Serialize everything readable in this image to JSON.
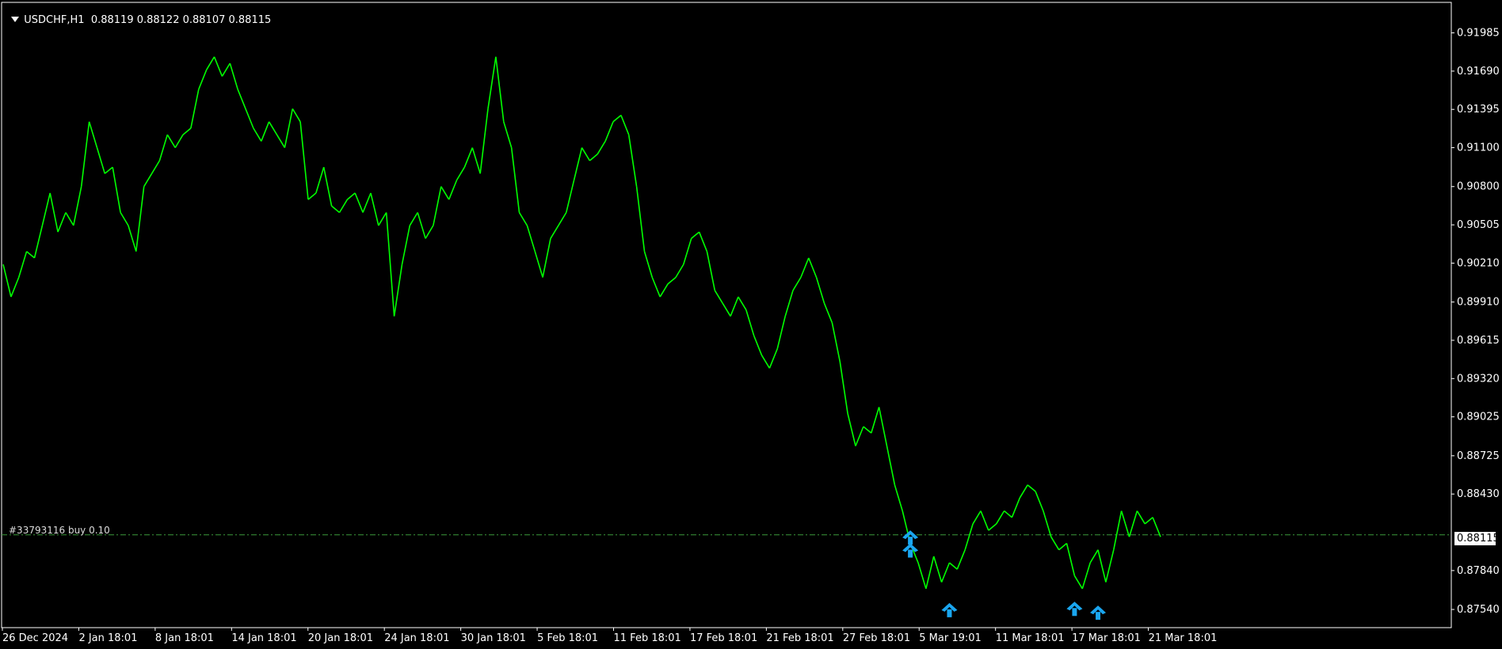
{
  "header": {
    "symbol": "USDCHF,H1",
    "ohlc": "0.88119 0.88122 0.88107 0.88115"
  },
  "order_line": {
    "label": "#33793116 buy 0.10",
    "price": 0.88115
  },
  "current_price_tag": "0.88115",
  "colors": {
    "background": "#000000",
    "price_line": "#00ff00",
    "arrow": "#1aa6f0",
    "grid_axis": "#ffffff",
    "order_line": "#3a9a3a"
  },
  "chart_data": {
    "type": "line",
    "title": "",
    "xlabel": "",
    "ylabel": "",
    "grid": false,
    "ylim": [
      0.874,
      0.9222
    ],
    "y_ticks": [
      "0.91985",
      "0.91690",
      "0.91395",
      "0.91100",
      "0.90800",
      "0.90505",
      "0.90210",
      "0.89910",
      "0.89615",
      "0.89320",
      "0.89025",
      "0.88725",
      "0.88430",
      "0.87840",
      "0.87540"
    ],
    "x_ticks": [
      "26 Dec 2024",
      "2 Jan 18:01",
      "8 Jan 18:01",
      "14 Jan 18:01",
      "20 Jan 18:01",
      "24 Jan 18:01",
      "30 Jan 18:01",
      "5 Feb 18:01",
      "11 Feb 18:01",
      "17 Feb 18:01",
      "21 Feb 18:01",
      "27 Feb 18:01",
      "5 Mar 19:01",
      "11 Mar 18:01",
      "17 Mar 18:01",
      "21 Mar 18:01"
    ],
    "series": [
      {
        "values": [
          0.902,
          0.8995,
          0.901,
          0.903,
          0.9025,
          0.905,
          0.9075,
          0.9045,
          0.906,
          0.905,
          0.908,
          0.913,
          0.911,
          0.909,
          0.9095,
          0.906,
          0.905,
          0.903,
          0.908,
          0.909,
          0.91,
          0.912,
          0.911,
          0.912,
          0.9125,
          0.9155,
          0.917,
          0.918,
          0.9165,
          0.9175,
          0.9155,
          0.914,
          0.9125,
          0.9115,
          0.913,
          0.912,
          0.911,
          0.914,
          0.913,
          0.907,
          0.9075,
          0.9095,
          0.9065,
          0.906,
          0.907,
          0.9075,
          0.906,
          0.9075,
          0.905,
          0.906,
          0.898,
          0.902,
          0.905,
          0.906,
          0.904,
          0.905,
          0.908,
          0.907,
          0.9085,
          0.9095,
          0.911,
          0.909,
          0.914,
          0.918,
          0.913,
          0.911,
          0.906,
          0.905,
          0.903,
          0.901,
          0.904,
          0.905,
          0.906,
          0.9085,
          0.911,
          0.91,
          0.9105,
          0.9115,
          0.913,
          0.9135,
          0.912,
          0.908,
          0.903,
          0.901,
          0.8995,
          0.9005,
          0.901,
          0.902,
          0.904,
          0.9045,
          0.903,
          0.9,
          0.899,
          0.898,
          0.8995,
          0.8985,
          0.8965,
          0.895,
          0.894,
          0.8955,
          0.898,
          0.9,
          0.901,
          0.9025,
          0.901,
          0.899,
          0.8975,
          0.8945,
          0.8905,
          0.888,
          0.8895,
          0.889,
          0.891,
          0.888,
          0.885,
          0.883,
          0.8805,
          0.879,
          0.877,
          0.8795,
          0.8775,
          0.879,
          0.8785,
          0.88,
          0.882,
          0.883,
          0.8815,
          0.882,
          0.883,
          0.8825,
          0.884,
          0.885,
          0.8845,
          0.883,
          0.881,
          0.88,
          0.8805,
          0.878,
          0.877,
          0.879,
          0.88,
          0.8775,
          0.88,
          0.883,
          0.881,
          0.883,
          0.882,
          0.8825,
          0.881
        ]
      }
    ],
    "buy_arrows": [
      {
        "index": 116,
        "price": 0.8815
      },
      {
        "index": 116,
        "price": 0.8805
      },
      {
        "index": 121,
        "price": 0.8759
      },
      {
        "index": 137,
        "price": 0.876
      },
      {
        "index": 140,
        "price": 0.8757
      }
    ]
  }
}
